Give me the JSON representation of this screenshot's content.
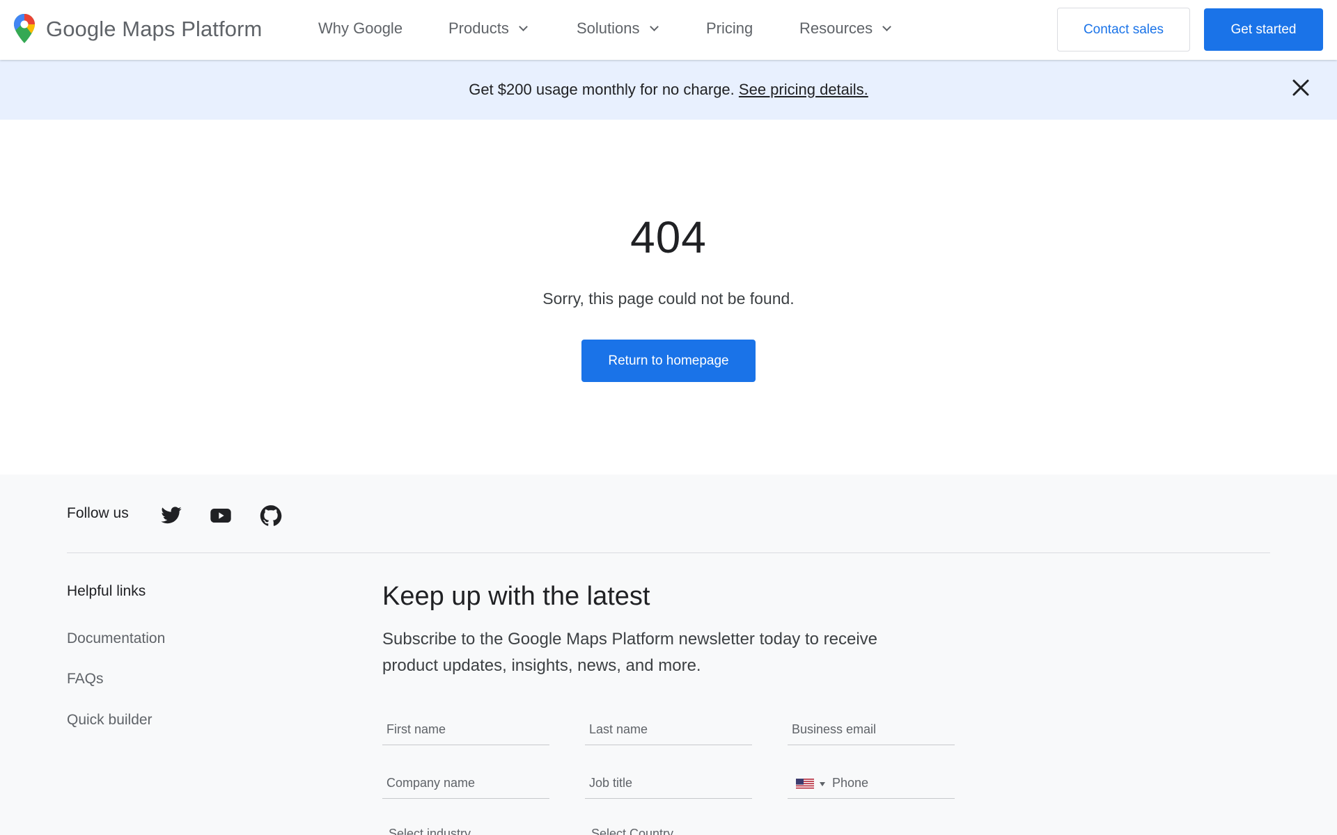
{
  "header": {
    "logo_text": "Google Maps Platform",
    "nav": [
      {
        "label": "Why Google",
        "dropdown": false
      },
      {
        "label": "Products",
        "dropdown": true
      },
      {
        "label": "Solutions",
        "dropdown": true
      },
      {
        "label": "Pricing",
        "dropdown": false
      },
      {
        "label": "Resources",
        "dropdown": true
      }
    ],
    "contact_label": "Contact sales",
    "get_started_label": "Get started"
  },
  "banner": {
    "text": "Get $200 usage monthly for no charge.",
    "link_text": "See pricing details.",
    "close_icon": "close-icon"
  },
  "error": {
    "code": "404",
    "message": "Sorry, this page could not be found.",
    "button_label": "Return to homepage"
  },
  "footer": {
    "follow_label": "Follow us",
    "social_icons": [
      "twitter-icon",
      "youtube-icon",
      "github-icon"
    ],
    "links_title": "Helpful links",
    "links": [
      "Documentation",
      "FAQs",
      "Quick builder"
    ],
    "newsletter": {
      "title": "Keep up with the latest",
      "description": "Subscribe to the Google Maps Platform newsletter today to receive product updates, insights, news, and more.",
      "fields": {
        "first_name": "First name",
        "last_name": "Last name",
        "email": "Business email",
        "company": "Company name",
        "job_title": "Job title",
        "phone": "Phone"
      },
      "selects": {
        "industry": "Select industry",
        "country": "Select Country"
      }
    }
  },
  "colors": {
    "accent": "#1a73e8",
    "banner_bg": "#e8f0fe",
    "footer_bg": "#f8f9fa"
  }
}
